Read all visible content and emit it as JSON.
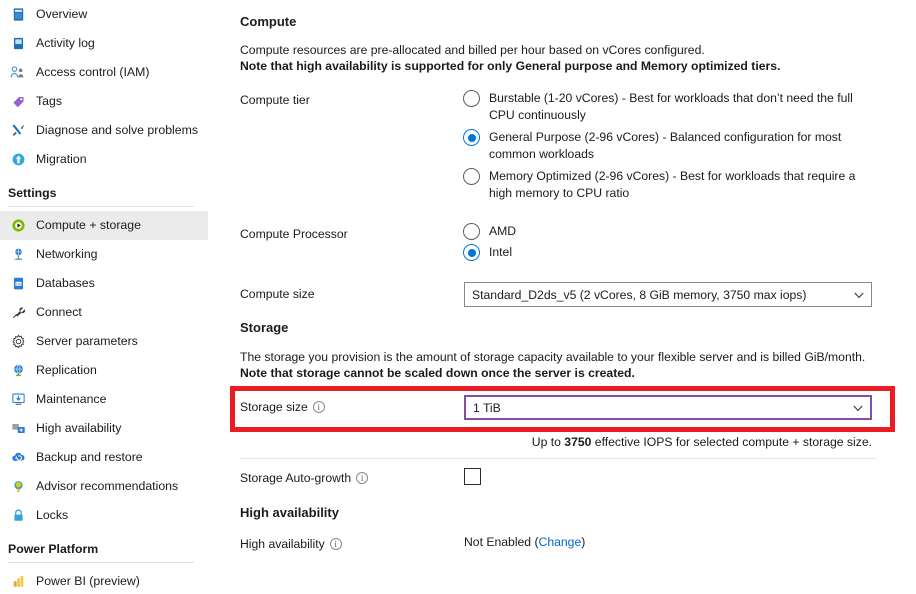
{
  "sidebar": {
    "items": [
      {
        "label": "Overview",
        "icon": "overview-icon",
        "selected": false
      },
      {
        "label": "Activity log",
        "icon": "activity-log-icon",
        "selected": false
      },
      {
        "label": "Access control (IAM)",
        "icon": "access-control-icon",
        "selected": false
      },
      {
        "label": "Tags",
        "icon": "tags-icon",
        "selected": false
      },
      {
        "label": "Diagnose and solve problems",
        "icon": "diagnose-icon",
        "selected": false
      },
      {
        "label": "Migration",
        "icon": "migration-icon",
        "selected": false
      }
    ],
    "settings_group_label": "Settings",
    "settings_items": [
      {
        "label": "Compute + storage",
        "icon": "compute-storage-icon",
        "selected": true
      },
      {
        "label": "Networking",
        "icon": "networking-icon",
        "selected": false
      },
      {
        "label": "Databases",
        "icon": "databases-icon",
        "selected": false
      },
      {
        "label": "Connect",
        "icon": "connect-icon",
        "selected": false
      },
      {
        "label": "Server parameters",
        "icon": "gear-icon",
        "selected": false
      },
      {
        "label": "Replication",
        "icon": "replication-icon",
        "selected": false
      },
      {
        "label": "Maintenance",
        "icon": "maintenance-icon",
        "selected": false
      },
      {
        "label": "High availability",
        "icon": "high-availability-icon",
        "selected": false
      },
      {
        "label": "Backup and restore",
        "icon": "backup-restore-icon",
        "selected": false
      },
      {
        "label": "Advisor recommendations",
        "icon": "advisor-icon",
        "selected": false
      },
      {
        "label": "Locks",
        "icon": "lock-icon",
        "selected": false
      }
    ],
    "power_platform_group_label": "Power Platform",
    "power_platform_items": [
      {
        "label": "Power BI (preview)",
        "icon": "power-bi-icon",
        "selected": false
      }
    ]
  },
  "main": {
    "compute": {
      "heading": "Compute",
      "desc_line1": "Compute resources are pre-allocated and billed per hour based on vCores configured.",
      "desc_line2": "Note that high availability is supported for only General purpose and Memory optimized tiers.",
      "tier_label": "Compute tier",
      "tier_options": [
        {
          "label": "Burstable (1-20 vCores) - Best for workloads that don’t need the full CPU continuously",
          "checked": false
        },
        {
          "label": "General Purpose (2-96 vCores) - Balanced configuration for most common workloads",
          "checked": true
        },
        {
          "label": "Memory Optimized (2-96 vCores) - Best for workloads that require a high memory to CPU ratio",
          "checked": false
        }
      ],
      "processor_label": "Compute Processor",
      "processor_options": [
        {
          "label": "AMD",
          "checked": false
        },
        {
          "label": "Intel",
          "checked": true
        }
      ],
      "size_label": "Compute size",
      "size_value": "Standard_D2ds_v5 (2 vCores, 8 GiB memory, 3750 max iops)"
    },
    "storage": {
      "heading": "Storage",
      "desc_line1": "The storage you provision is the amount of storage capacity available to your flexible server and is billed GiB/month.",
      "desc_line2": "Note that storage cannot be scaled down once the server is created.",
      "size_label": "Storage size",
      "size_value": "1 TiB",
      "iops_prefix": "Up to ",
      "iops_value": "3750",
      "iops_suffix": " effective IOPS for selected compute + storage size.",
      "autogrowth_label": "Storage Auto-growth",
      "autogrowth_checked": false
    },
    "high_availability": {
      "heading": "High availability",
      "field_label": "High availability",
      "status_prefix": "Not Enabled (",
      "change_link": "Change",
      "status_suffix": ")"
    }
  },
  "colors": {
    "accent": "#0078d4",
    "highlight_box": "#ec1c24",
    "focused_border": "#8250a8",
    "link": "#0066cc",
    "selected_nav_bg": "#ebebeb"
  }
}
